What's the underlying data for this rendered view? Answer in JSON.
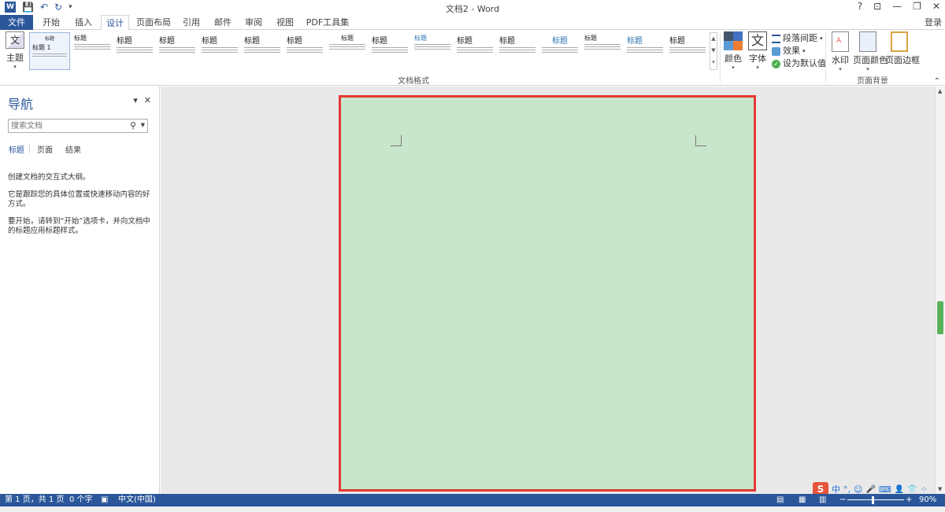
{
  "window": {
    "title": "文档2 - Word",
    "help": "?",
    "restore_ribbon": "⊡",
    "minimize": "—",
    "maximize": "❐",
    "close": "✕"
  },
  "qat": {
    "undo": "↶",
    "redo": "↻",
    "customize": "▾"
  },
  "tabs": [
    {
      "label": "文件"
    },
    {
      "label": "开始"
    },
    {
      "label": "插入"
    },
    {
      "label": "设计"
    },
    {
      "label": "页面布局"
    },
    {
      "label": "引用"
    },
    {
      "label": "邮件"
    },
    {
      "label": "审阅"
    },
    {
      "label": "视图"
    },
    {
      "label": "PDF工具集"
    }
  ],
  "active_tab": "设计",
  "login": "登录",
  "ribbon": {
    "theme_label": "主题",
    "theme_icon_text": "文",
    "styles_group_label": "文档格式",
    "style_thumbs": [
      {
        "heading": "标题 1"
      },
      {
        "heading": "标题"
      },
      {
        "heading": "标题"
      },
      {
        "heading": "标题"
      },
      {
        "heading": "标题"
      },
      {
        "heading": "标题"
      },
      {
        "heading": "标题"
      },
      {
        "heading": "标题"
      },
      {
        "heading": "标题"
      },
      {
        "heading": "标题"
      },
      {
        "heading": "标题"
      },
      {
        "heading": "标题"
      },
      {
        "heading": "标题"
      },
      {
        "heading": "标题"
      },
      {
        "heading": "标题"
      },
      {
        "heading": "标题"
      }
    ],
    "colors_label": "颜色",
    "fonts_label": "字体",
    "fonts_icon_text": "文",
    "paragraph_spacing": "段落间距",
    "effects": "效果",
    "set_default": "设为默认值",
    "watermark": "水印",
    "page_color": "页面颜色",
    "page_borders": "页面边框",
    "page_background_group_label": "页面背景",
    "collapse": "⌃"
  },
  "navigation": {
    "title": "导航",
    "search_placeholder": "搜索文档",
    "tabs": [
      {
        "label": "标题"
      },
      {
        "label": "页面"
      },
      {
        "label": "结果"
      }
    ],
    "text1": "创建文档的交互式大纲。",
    "text2": "它是跟踪您的具体位置或快速移动内容的好方式。",
    "text3": "要开始，请转到“开始”选项卡，并向文档中的标题应用标题样式。"
  },
  "document": {
    "page_color": "#c7e6cb",
    "highlight_border": "#e53935"
  },
  "status": {
    "page": "第 1 页，共 1 页",
    "words": "0 个字",
    "language": "中文(中国)",
    "zoom": "90%"
  },
  "ime": {
    "logo": "S",
    "mode": "中",
    "punct": "°,",
    "emoji": "☺",
    "mic": "🎤",
    "keyboard": "⌨",
    "user": "👤",
    "skin": "👕",
    "grid": "⁘"
  },
  "colors": {
    "accent": "#2b579a",
    "status_bar": "#2b579a",
    "file_tab": "#2b579a"
  }
}
